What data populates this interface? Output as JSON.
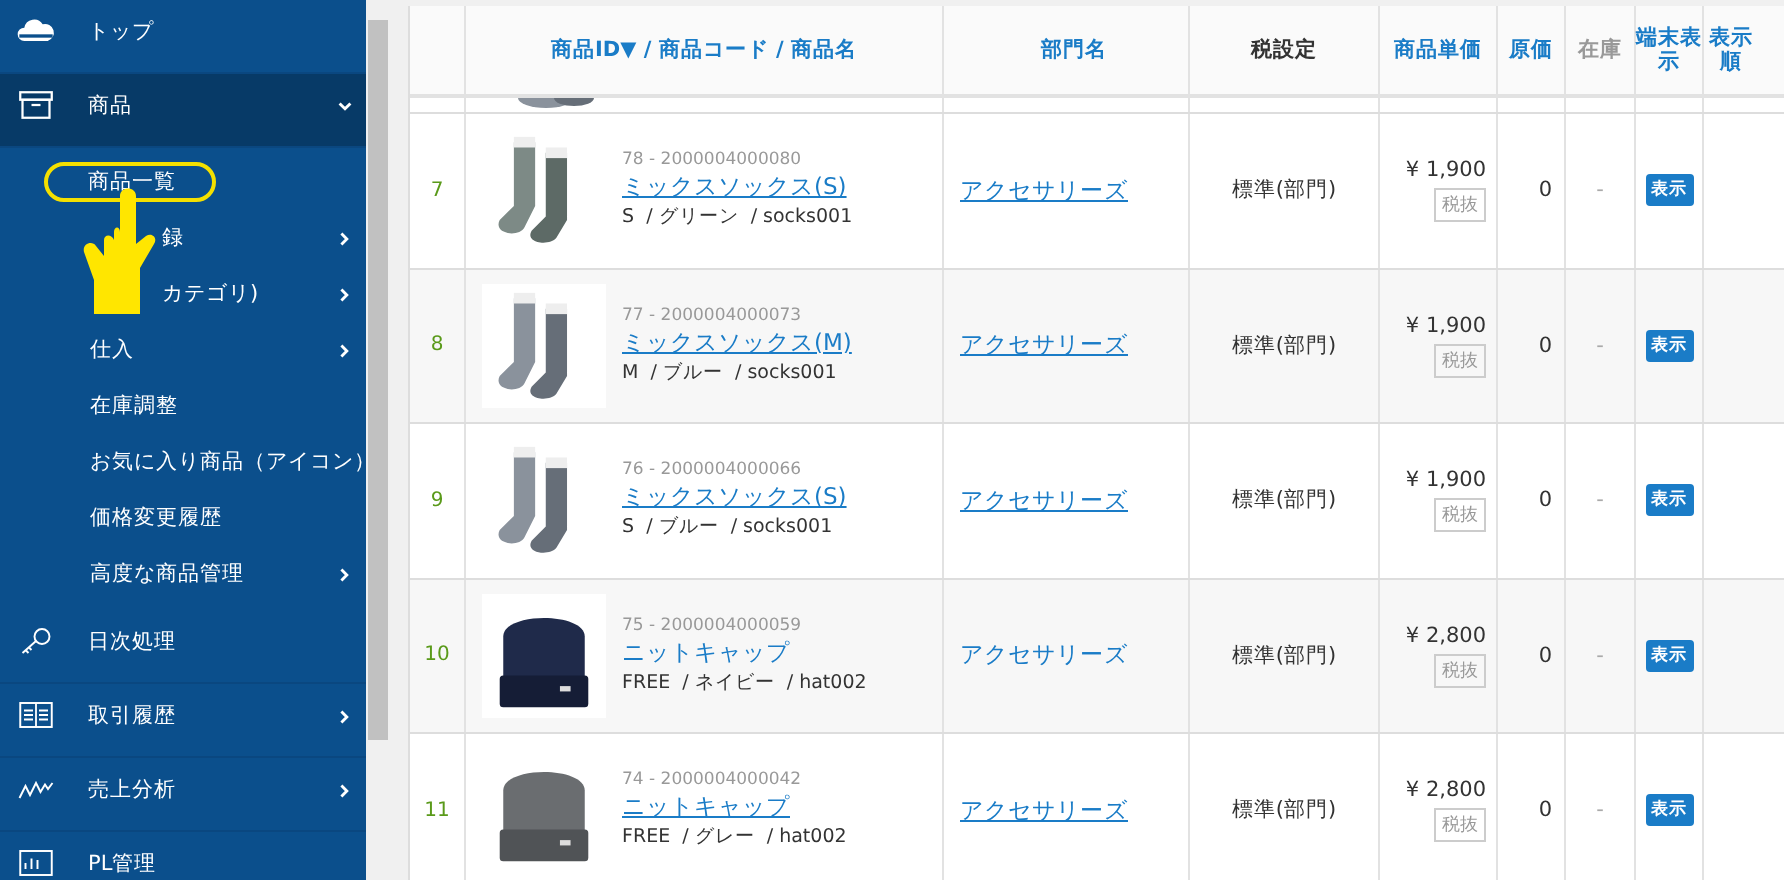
{
  "sidebar": {
    "items": [
      {
        "label": "トップ",
        "expanded": false,
        "has_children": false
      },
      {
        "label": "商品",
        "expanded": true,
        "has_children": true,
        "children": [
          {
            "label": "商品一覧",
            "selected": true,
            "has_children": false
          },
          {
            "label": "録",
            "selected": false,
            "has_children": true
          },
          {
            "label": "カテゴリ)",
            "selected": false,
            "has_children": true
          },
          {
            "label": "仕入",
            "selected": false,
            "has_children": true
          },
          {
            "label": "在庫調整",
            "selected": false,
            "has_children": false
          },
          {
            "label": "お気に入り商品（アイコン）",
            "selected": false,
            "has_children": false
          },
          {
            "label": "価格変更履歴",
            "selected": false,
            "has_children": false
          },
          {
            "label": "高度な商品管理",
            "selected": false,
            "has_children": true
          }
        ]
      },
      {
        "label": "日次処理",
        "expanded": false,
        "has_children": false
      },
      {
        "label": "取引履歴",
        "expanded": false,
        "has_children": true
      },
      {
        "label": "売上分析",
        "expanded": false,
        "has_children": true
      },
      {
        "label": "PL管理",
        "expanded": false,
        "has_children": false
      }
    ]
  },
  "table": {
    "columns": [
      {
        "kind": "blank"
      },
      {
        "label": "商品ID▼ / 商品コード / 商品名",
        "kind": "link"
      },
      {
        "label": "部門名",
        "kind": "link"
      },
      {
        "label": "税設定",
        "kind": "plain"
      },
      {
        "label": "商品単価",
        "kind": "link"
      },
      {
        "label": "原価",
        "kind": "link"
      },
      {
        "label": "在庫",
        "kind": "muted"
      },
      {
        "label": "端末表示",
        "kind": "link"
      },
      {
        "label": "表示順",
        "kind": "link"
      }
    ],
    "rows": [
      {
        "number": "7",
        "kind": "socks",
        "code": "78 - 2000004000080",
        "name": "ミックスソックス(S)",
        "variant": "S  / グリーン  / socks001",
        "department": "アクセサリーズ",
        "tax": "標準(部門)",
        "price": "¥ 1,900",
        "tax_badge": "税抜",
        "cost": "0",
        "stock": "-",
        "display": "表示",
        "hovered": false
      },
      {
        "number": "8",
        "kind": "socks",
        "code": "77 - 2000004000073",
        "name": "ミックスソックス(M)",
        "variant": "M  / ブルー  / socks001",
        "department": "アクセサリーズ",
        "tax": "標準(部門)",
        "price": "¥ 1,900",
        "tax_badge": "税抜",
        "cost": "0",
        "stock": "-",
        "display": "表示",
        "hovered": false
      },
      {
        "number": "9",
        "kind": "socks",
        "code": "76 - 2000004000066",
        "name": "ミックスソックス(S)",
        "variant": "S  / ブルー  / socks001",
        "department": "アクセサリーズ",
        "tax": "標準(部門)",
        "price": "¥ 1,900",
        "tax_badge": "税抜",
        "cost": "0",
        "stock": "-",
        "display": "表示",
        "hovered": false
      },
      {
        "number": "10",
        "kind": "hat",
        "code": "75 - 2000004000059",
        "name": "ニットキャップ",
        "variant": "FREE  / ネイビー  / hat002",
        "department": "アクセサリーズ",
        "tax": "標準(部門)",
        "price": "¥ 2,800",
        "tax_badge": "税抜",
        "cost": "0",
        "stock": "-",
        "display": "表示",
        "hovered": true
      },
      {
        "number": "11",
        "kind": "hat",
        "code": "74 - 2000004000042",
        "name": "ニットキャップ",
        "variant": "FREE  / グレー  / hat002",
        "department": "アクセサリーズ",
        "tax": "標準(部門)",
        "price": "¥ 2,800",
        "tax_badge": "税抜",
        "cost": "0",
        "stock": "-",
        "display": "表示",
        "hovered": false
      }
    ]
  }
}
